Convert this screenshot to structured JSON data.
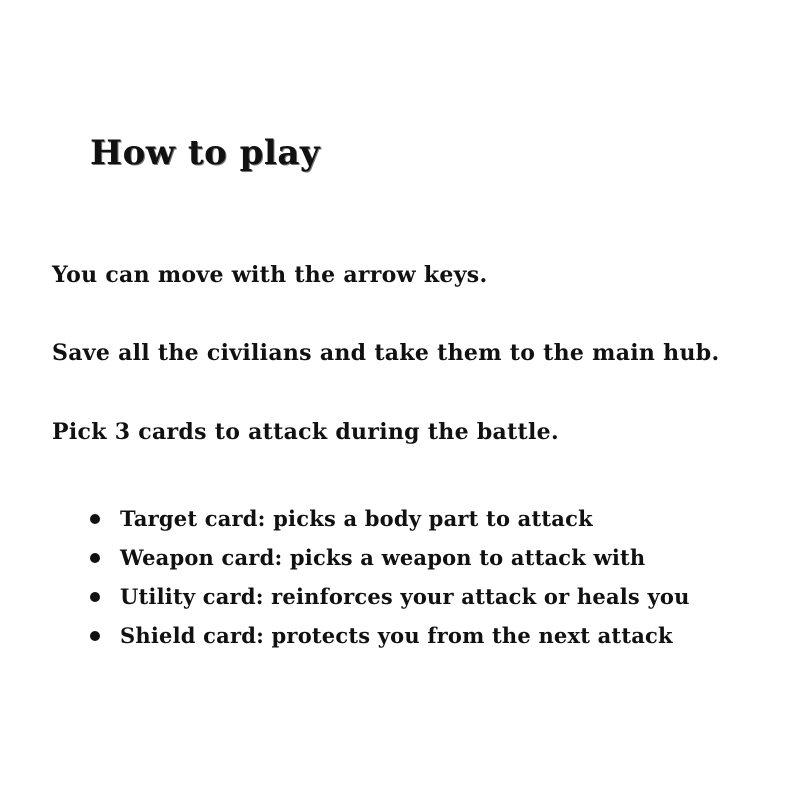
{
  "title": "How to play",
  "instructions": [
    "You can move with the arrow keys.",
    "Save all the civilians and take them to the main hub.",
    "Pick 3 cards to attack during the battle."
  ],
  "cards": [
    "Target card: picks a body part to attack",
    "Weapon card: picks a weapon to attack with",
    "Utility card: reinforces your attack or heals you",
    "Shield card: protects you from the next attack"
  ]
}
